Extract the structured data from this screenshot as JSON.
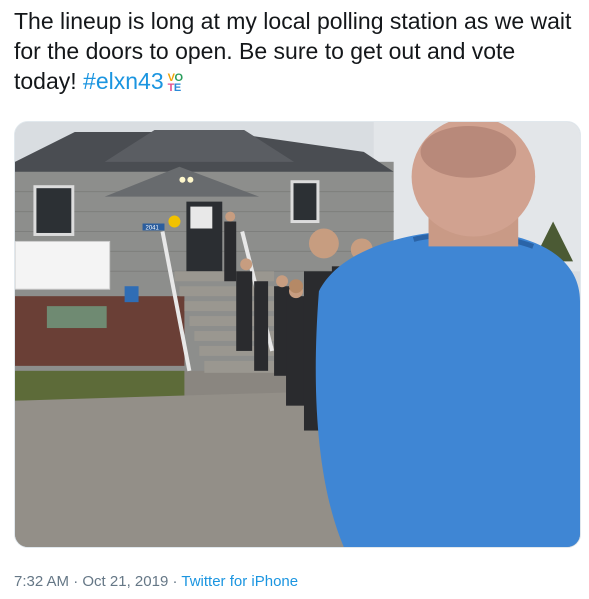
{
  "tweet": {
    "text": "The lineup is long at my local polling station as we wait for the doors to open. Be sure to get out and vote today!",
    "hashtag": "#elxn43",
    "emoji_top": "VO",
    "emoji_bottom": "TE",
    "time": "7:32 AM",
    "separator": "·",
    "date": "Oct 21, 2019",
    "source": "Twitter for iPhone"
  },
  "photo": {
    "house_number": "2041"
  },
  "colors": {
    "link": "#1b95e0",
    "meta": "#657786",
    "text": "#14171a"
  }
}
